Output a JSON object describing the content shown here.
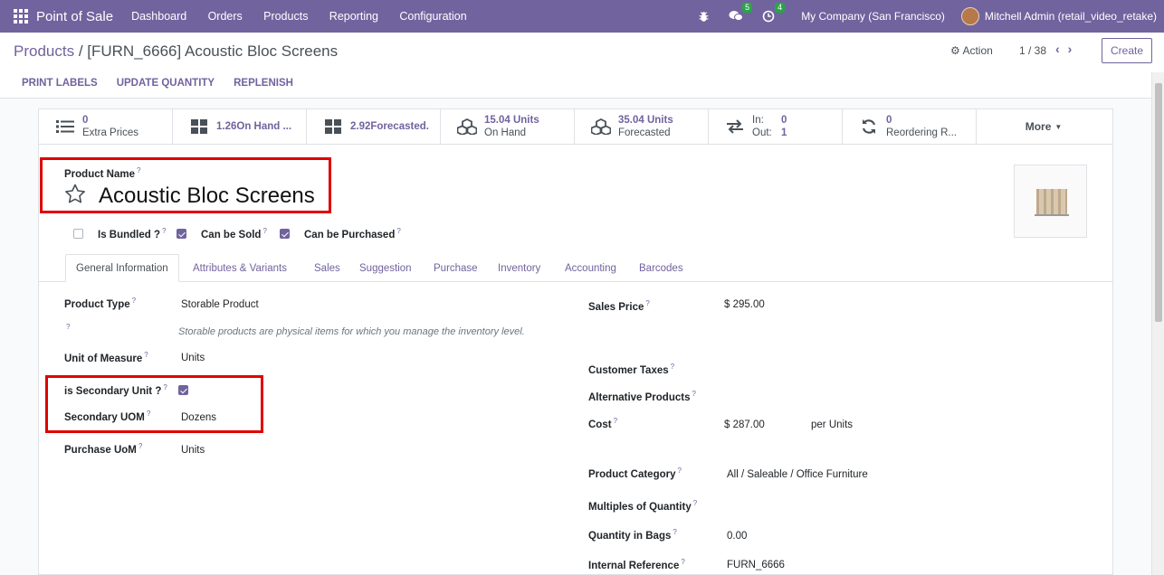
{
  "navbar": {
    "app_name": "Point of Sale",
    "menu": [
      "Dashboard",
      "Orders",
      "Products",
      "Reporting",
      "Configuration"
    ],
    "messages_count": "5",
    "activities_count": "4",
    "company": "My Company (San Francisco)",
    "user": "Mitchell Admin (retail_video_retake)"
  },
  "breadcrumb": {
    "parent": "Products",
    "separator": " / ",
    "current": "[FURN_6666] Acoustic Bloc Screens"
  },
  "control": {
    "action_label": "Action",
    "pager": "1 / 38",
    "create_label": "Create",
    "status_buttons": [
      "PRINT LABELS",
      "UPDATE QUANTITY",
      "REPLENISH"
    ]
  },
  "smart_buttons": {
    "extra_prices": {
      "value": "0",
      "label": "Extra Prices"
    },
    "on_hand_short": "1.26On Hand ...",
    "forecasted_short": "2.92Forecasted.",
    "on_hand": {
      "value": "15.04 Units",
      "label": "On Hand"
    },
    "forecasted": {
      "value": "35.04 Units",
      "label": "Forecasted"
    },
    "in_out": {
      "in_label": "In:",
      "in_value": "0",
      "out_label": "Out:",
      "out_value": "1"
    },
    "reordering": {
      "value": "0",
      "label": "Reordering R..."
    },
    "more": "More"
  },
  "product": {
    "name_label": "Product Name",
    "name": "Acoustic Bloc Screens",
    "is_bundled_label": "Is Bundled ?",
    "can_be_sold_label": "Can be Sold",
    "can_be_purchased_label": "Can be Purchased"
  },
  "tabs": [
    "General Information",
    "Attributes & Variants",
    "Sales",
    "Suggestion",
    "Purchase",
    "Inventory",
    "Accounting",
    "Barcodes"
  ],
  "general": {
    "product_type_label": "Product Type",
    "product_type": "Storable Product",
    "product_type_help": "Storable products are physical items for which you manage the inventory level.",
    "uom_label": "Unit of Measure",
    "uom": "Units",
    "is_secondary_unit_label": "is Secondary Unit ?",
    "secondary_uom_label": "Secondary UOM",
    "secondary_uom": "Dozens",
    "purchase_uom_label": "Purchase UoM",
    "purchase_uom": "Units",
    "sales_price_label": "Sales Price",
    "sales_price": "$ 295.00",
    "customer_taxes_label": "Customer Taxes",
    "alternative_products_label": "Alternative Products",
    "cost_label": "Cost",
    "cost": "$ 287.00",
    "cost_per": "per Units",
    "product_category_label": "Product Category",
    "product_category": "All / Saleable / Office Furniture",
    "multiples_label": "Multiples of Quantity",
    "qty_bags_label": "Quantity in Bags",
    "qty_bags": "0.00",
    "internal_ref_label": "Internal Reference",
    "internal_ref": "FURN_6666"
  },
  "colors": {
    "brand": "#71639e",
    "highlight": "#e00000"
  }
}
